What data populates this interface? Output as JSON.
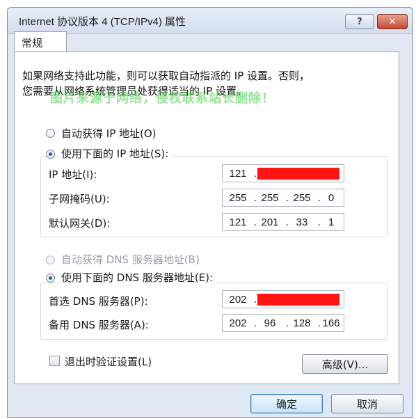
{
  "window": {
    "title": "Internet 协议版本 4 (TCP/IPv4) 属性",
    "help": "?",
    "close": "✕"
  },
  "tab": {
    "label": "常规"
  },
  "description": {
    "line1": "如果网络支持此功能，则可以获取自动指派的 IP 设置。否则，",
    "line2": "您需要从网络系统管理员处获得适当的 IP 设置。"
  },
  "watermark": "图片来源于网络，侵权联系站长删除！",
  "ip_section": {
    "auto_label": "自动获得 IP 地址(O)",
    "manual_label": "使用下面的 IP 地址(S):",
    "ip_label": "IP 地址(I):",
    "ip_value": {
      "o1": "121",
      "o2": "",
      "o3": "",
      "o4": ""
    },
    "mask_label": "子网掩码(U):",
    "mask_value": {
      "o1": "255",
      "o2": "255",
      "o3": "255",
      "o4": "0"
    },
    "gateway_label": "默认网关(D):",
    "gateway_value": {
      "o1": "121",
      "o2": "201",
      "o3": "33",
      "o4": "1"
    }
  },
  "dns_section": {
    "auto_label": "自动获得 DNS 服务器地址(B)",
    "manual_label": "使用下面的 DNS 服务器地址(E):",
    "preferred_label": "首选 DNS 服务器(P):",
    "preferred_value": {
      "o1": "202",
      "o2": "",
      "o3": "",
      "o4": ""
    },
    "alternate_label": "备用 DNS 服务器(A):",
    "alternate_value": {
      "o1": "202",
      "o2": "96",
      "o3": "128",
      "o4": "166"
    }
  },
  "validate_label": "退出时验证设置(L)",
  "buttons": {
    "advanced": "高级(V)...",
    "ok": "确定",
    "cancel": "取消"
  },
  "colors": {
    "redaction": "#ff1414",
    "radio_selected": "#1f57c8"
  }
}
